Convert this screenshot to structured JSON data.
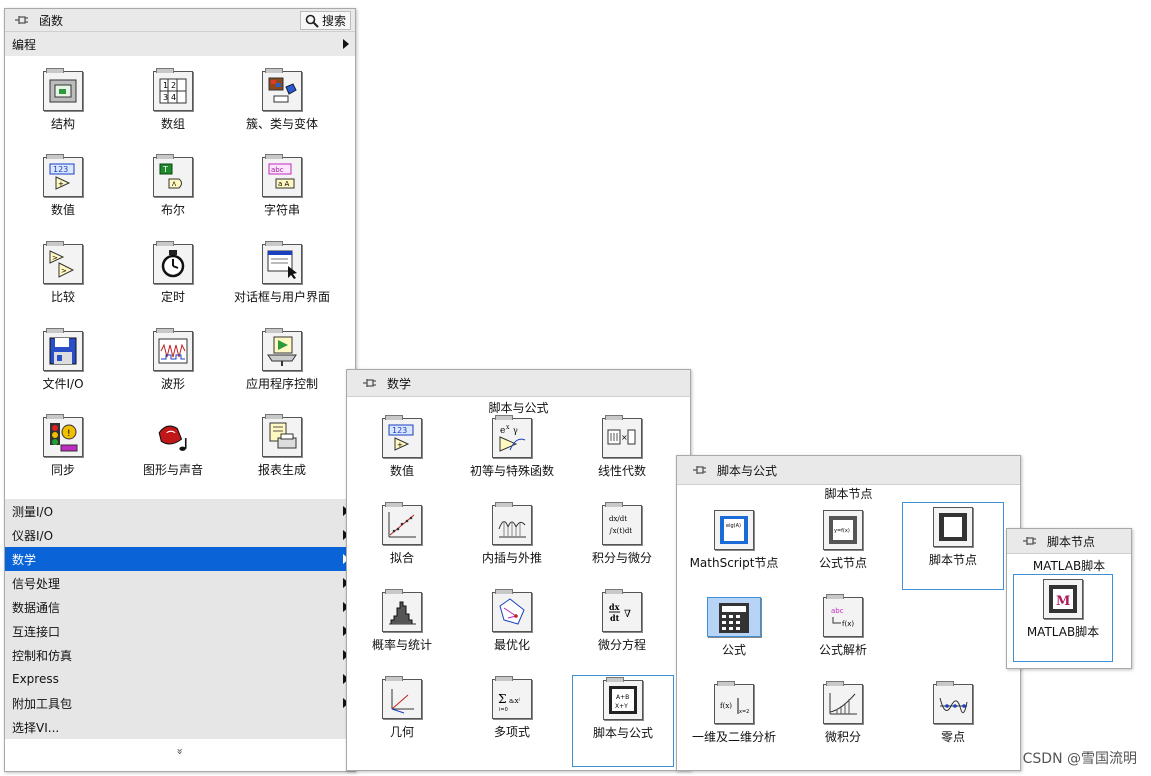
{
  "functions": {
    "title": "函数",
    "search": "搜索",
    "programming": "编程",
    "tiles": [
      {
        "label": "结构"
      },
      {
        "label": "数组"
      },
      {
        "label": "簇、类与变体"
      },
      {
        "label": "数值"
      },
      {
        "label": "布尔"
      },
      {
        "label": "字符串"
      },
      {
        "label": "比较"
      },
      {
        "label": "定时"
      },
      {
        "label": "对话框与用户界面"
      },
      {
        "label": "文件I/O"
      },
      {
        "label": "波形"
      },
      {
        "label": "应用程序控制"
      },
      {
        "label": "同步"
      },
      {
        "label": "图形与声音"
      },
      {
        "label": "报表生成"
      }
    ],
    "categories": [
      {
        "label": "测量I/O",
        "arrow": true
      },
      {
        "label": "仪器I/O",
        "arrow": true
      },
      {
        "label": "数学",
        "arrow": true,
        "selected": true
      },
      {
        "label": "信号处理",
        "arrow": true
      },
      {
        "label": "数据通信",
        "arrow": true
      },
      {
        "label": "互连接口",
        "arrow": true
      },
      {
        "label": "控制和仿真",
        "arrow": true
      },
      {
        "label": "Express",
        "arrow": true
      },
      {
        "label": "附加工具包",
        "arrow": true
      },
      {
        "label": "选择VI...",
        "arrow": false
      }
    ],
    "more": "»"
  },
  "math": {
    "title": "数学",
    "section": "脚本与公式",
    "tiles": [
      {
        "label": "数值"
      },
      {
        "label": "初等与特殊函数"
      },
      {
        "label": "线性代数"
      },
      {
        "label": "拟合"
      },
      {
        "label": "内插与外推"
      },
      {
        "label": "积分与微分"
      },
      {
        "label": "概率与统计"
      },
      {
        "label": "最优化"
      },
      {
        "label": "微分方程"
      },
      {
        "label": "几何"
      },
      {
        "label": "多项式"
      },
      {
        "label": "脚本与公式"
      }
    ]
  },
  "scripts": {
    "title": "脚本与公式",
    "section": "脚本节点",
    "tiles": [
      {
        "label": "MathScript节点"
      },
      {
        "label": "公式节点"
      },
      {
        "label": "脚本节点"
      },
      {
        "label": "公式"
      },
      {
        "label": "公式解析"
      },
      {
        "label": "一维及二维分析"
      },
      {
        "label": "微积分"
      },
      {
        "label": "零点"
      }
    ]
  },
  "nodes": {
    "title": "脚本节点",
    "section": "MATLAB脚本",
    "tiles": [
      {
        "label": "MATLAB脚本"
      }
    ]
  },
  "watermark": "CSDN @雪国流明",
  "colors": {
    "selection": "#0a64d7",
    "category_bg": "#e6e6e6",
    "titlebar": "#e9e9e9",
    "tile_border": "#3d8fd6"
  }
}
